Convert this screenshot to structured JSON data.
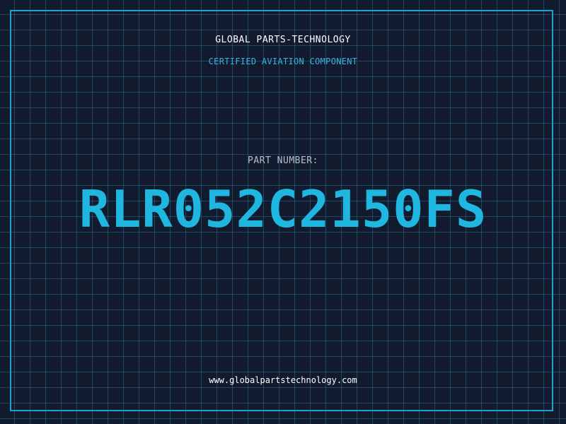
{
  "header": {
    "title": "GLOBAL PARTS-TECHNOLOGY",
    "subtitle": "CERTIFIED AVIATION COMPONENT"
  },
  "part": {
    "label": "PART NUMBER:",
    "number": "RLR052C2150FS"
  },
  "footer": {
    "url": "www.globalpartstechnology.com"
  },
  "colors": {
    "background": "#121a2e",
    "grid": "#226e8c",
    "frame": "#22a3cf",
    "accent": "#1fb7e0",
    "subtitle": "#3ab3de",
    "label": "#b6c0cc",
    "text": "#ffffff"
  }
}
